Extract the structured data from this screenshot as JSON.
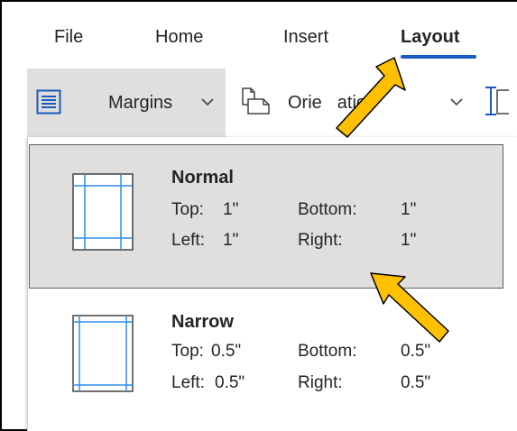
{
  "tabs": [
    {
      "label": "File"
    },
    {
      "label": "Home"
    },
    {
      "label": "Insert"
    },
    {
      "label": "Layout",
      "active": true
    }
  ],
  "ribbon": {
    "margins_label": "Margins",
    "orientation_label": "Orientation",
    "orientation_visible": "Orie",
    "orientation_visible_tail": "ation",
    "margins_icon": "margins-icon",
    "orientation_icon": "orientation-icon",
    "size_icon": "size-icon",
    "chevron_icon": "chevron-down-icon"
  },
  "margins_options": [
    {
      "title": "Normal",
      "top_label": "Top:",
      "top": "1\"",
      "bottom_label": "Bottom:",
      "bottom": "1\"",
      "left_label": "Left:",
      "left": "1\"",
      "right_label": "Right:",
      "right": "1\"",
      "selected": true
    },
    {
      "title": "Narrow",
      "top_label": "Top:",
      "top": "0.5\"",
      "bottom_label": "Bottom:",
      "bottom": "0.5\"",
      "left_label": "Left:",
      "left": "0.5\"",
      "right_label": "Right:",
      "right": "0.5\"",
      "selected": false
    }
  ],
  "colors": {
    "accent": "#185abd",
    "selected_bg": "#e1dfdd",
    "annotation_arrow": "#ffc000",
    "page_guide": "#2e8ee6"
  }
}
